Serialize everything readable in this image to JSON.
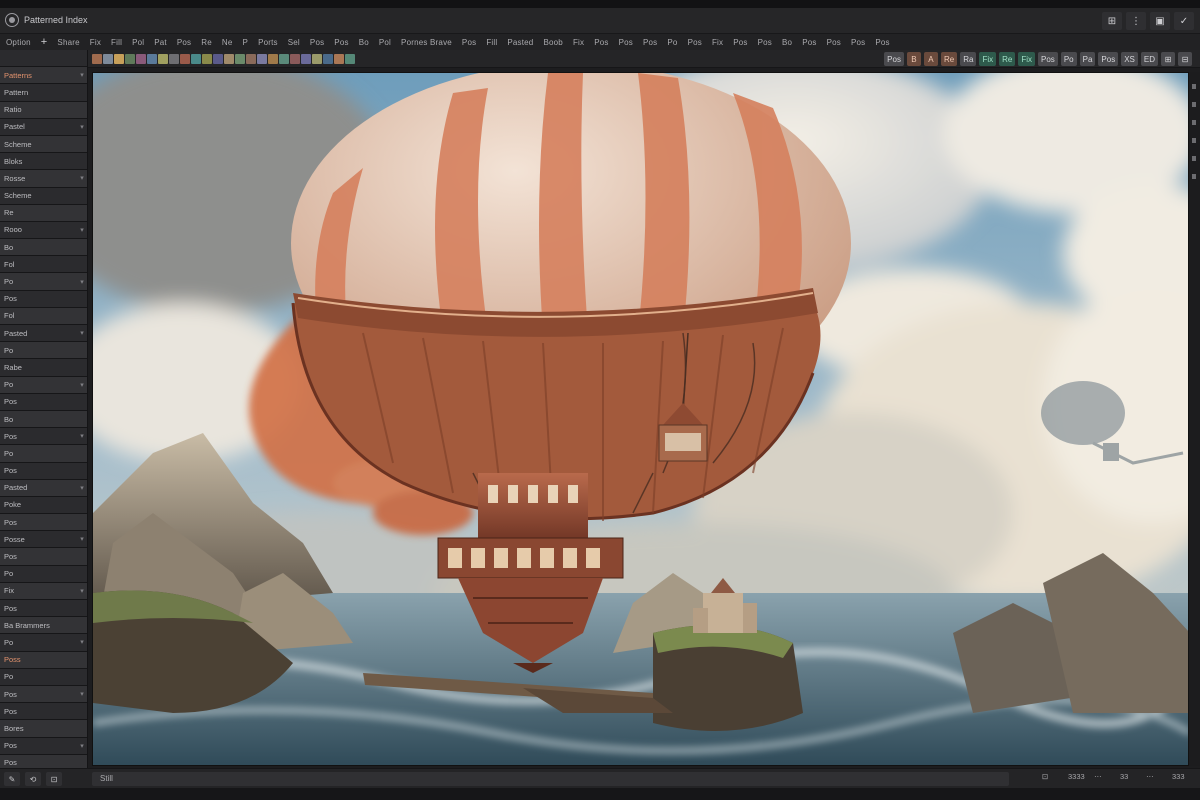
{
  "window": {
    "title": "Patterned Index",
    "buttons": [
      "⊞",
      "⋮",
      "▣",
      "✓"
    ]
  },
  "menubar": {
    "items": [
      "Option",
      "+",
      "Share",
      "Fix",
      "Fill",
      "Pol",
      "Pat",
      "Pos",
      "Re",
      "Ne",
      "P",
      "Ports",
      "Sel",
      "Pos",
      "Pos",
      "Bo",
      "Pol",
      "Pornes Brave",
      "Pos",
      "Fill",
      "Pasted",
      "Boob",
      "Fix",
      "Pos",
      "Pos",
      "Pos",
      "Po",
      "Pos",
      "Fix",
      "Pos",
      "Pos",
      "Bo",
      "Pos",
      "Pos",
      "Pos",
      "Pos"
    ]
  },
  "toolstrip": {
    "swatch_colors": [
      "#a06b4e",
      "#7d8a9a",
      "#c7a05a",
      "#5f7a5a",
      "#8a5a7a",
      "#5a7a9a",
      "#a0a060",
      "#6e6e72",
      "#9a5a4a",
      "#4a8a8a",
      "#8a8a4a",
      "#5a5a8a",
      "#a08a6a",
      "#6a8a6a",
      "#8a6a5a",
      "#7a7aa0",
      "#a07a4a",
      "#5a8a7a",
      "#8a5a5a",
      "#6a6a9a",
      "#9a9a6a",
      "#4a6a8a",
      "#aa7755",
      "#558877"
    ],
    "buttons": [
      {
        "label": "Pos",
        "style": "grey"
      },
      {
        "label": "B",
        "style": "orange"
      },
      {
        "label": "A",
        "style": "orange"
      },
      {
        "label": "Re",
        "style": "orange"
      },
      {
        "label": "Ra",
        "style": "grey"
      },
      {
        "label": "Fix",
        "style": "green"
      },
      {
        "label": "Re",
        "style": "green"
      },
      {
        "label": "Fix",
        "style": "green"
      },
      {
        "label": "Pos",
        "style": "grey"
      },
      {
        "label": "Po",
        "style": "grey"
      },
      {
        "label": "Pa",
        "style": "grey"
      },
      {
        "label": "Pos",
        "style": "grey"
      },
      {
        "label": "XS",
        "style": "grey"
      },
      {
        "label": "ED",
        "style": "grey"
      },
      {
        "label": "⊞",
        "style": "grey"
      },
      {
        "label": "⊟",
        "style": "grey"
      }
    ]
  },
  "leftpanel": {
    "rows": [
      {
        "label": "",
        "style": ""
      },
      {
        "label": "Patterns",
        "style": "orange"
      },
      {
        "label": "Pattern",
        "style": ""
      },
      {
        "label": "Ratio",
        "style": ""
      },
      {
        "label": "Pastel",
        "style": ""
      },
      {
        "label": "Scheme",
        "style": ""
      },
      {
        "label": "Bloks",
        "style": ""
      },
      {
        "label": "Rosse",
        "style": ""
      },
      {
        "label": "Scheme",
        "style": ""
      },
      {
        "label": "Re",
        "style": ""
      },
      {
        "label": "Rooo",
        "style": ""
      },
      {
        "label": "Bo",
        "style": ""
      },
      {
        "label": "Fol",
        "style": ""
      },
      {
        "label": "Po",
        "style": ""
      },
      {
        "label": "Pos",
        "style": ""
      },
      {
        "label": "Fol",
        "style": ""
      },
      {
        "label": "Pasted",
        "style": ""
      },
      {
        "label": "Po",
        "style": ""
      },
      {
        "label": "Rabe",
        "style": ""
      },
      {
        "label": "Po",
        "style": ""
      },
      {
        "label": "Pos",
        "style": ""
      },
      {
        "label": "Bo",
        "style": ""
      },
      {
        "label": "Pos",
        "style": ""
      },
      {
        "label": "Po",
        "style": ""
      },
      {
        "label": "Pos",
        "style": ""
      },
      {
        "label": "Pasted",
        "style": ""
      },
      {
        "label": "Poke",
        "style": ""
      },
      {
        "label": "Pos",
        "style": ""
      },
      {
        "label": "Posse",
        "style": ""
      },
      {
        "label": "Pos",
        "style": ""
      },
      {
        "label": "Po",
        "style": ""
      },
      {
        "label": "Fix",
        "style": ""
      },
      {
        "label": "Pos",
        "style": ""
      },
      {
        "label": "Ba Brammers",
        "style": ""
      },
      {
        "label": "Po",
        "style": ""
      },
      {
        "label": "Poss",
        "style": "orange"
      },
      {
        "label": "Po",
        "style": ""
      },
      {
        "label": "Pos",
        "style": ""
      },
      {
        "label": "Pos",
        "style": ""
      },
      {
        "label": "Bores",
        "style": ""
      },
      {
        "label": "Pos",
        "style": ""
      },
      {
        "label": "Pos",
        "style": ""
      }
    ]
  },
  "statusbar": {
    "icons": [
      "✎",
      "⟲",
      "⊡"
    ],
    "field_text": "Still",
    "right_values": [
      "⊡",
      "3333",
      "⋯",
      "33",
      "⋯",
      "333"
    ]
  }
}
